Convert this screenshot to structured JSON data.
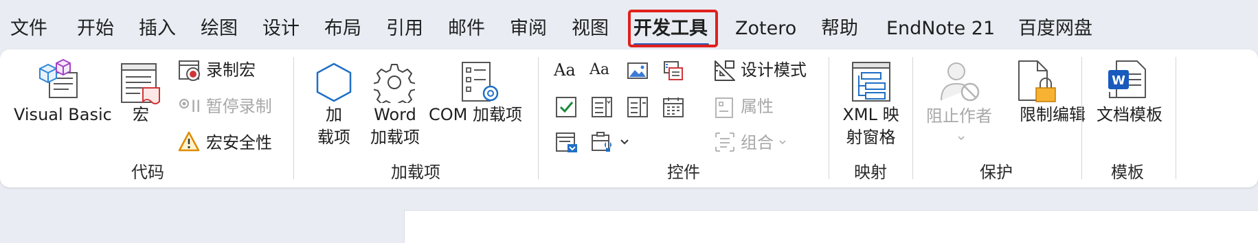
{
  "tabs": [
    {
      "id": "file",
      "label": "文件"
    },
    {
      "id": "home",
      "label": "开始"
    },
    {
      "id": "insert",
      "label": "插入"
    },
    {
      "id": "draw",
      "label": "绘图"
    },
    {
      "id": "design",
      "label": "设计"
    },
    {
      "id": "layout",
      "label": "布局"
    },
    {
      "id": "references",
      "label": "引用"
    },
    {
      "id": "mailings",
      "label": "邮件"
    },
    {
      "id": "review",
      "label": "审阅"
    },
    {
      "id": "view",
      "label": "视图"
    },
    {
      "id": "developer",
      "label": "开发工具",
      "active": true
    },
    {
      "id": "zotero",
      "label": "Zotero"
    },
    {
      "id": "help",
      "label": "帮助"
    },
    {
      "id": "endnote",
      "label": "EndNote 21"
    },
    {
      "id": "baidu",
      "label": "百度网盘"
    }
  ],
  "groups": {
    "code": {
      "label": "代码",
      "visual_basic": "Visual Basic",
      "macros": "宏",
      "record_macro": "录制宏",
      "pause_recording": "II 暂停录制",
      "macro_security": "宏安全性"
    },
    "addins": {
      "label": "加载项",
      "addins_line1": "加",
      "addins_line2": "载项",
      "word_addins_line1": "Word",
      "word_addins_line2": "加载项",
      "com_addins": "COM 加载项"
    },
    "controls": {
      "label": "控件",
      "design_mode": "设计模式",
      "properties": "属性",
      "group": "组合"
    },
    "mapping": {
      "label": "映射",
      "xml_line1": "XML 映",
      "xml_line2": "射窗格"
    },
    "protect": {
      "label": "保护",
      "block_authors": "阻止作者",
      "restrict_editing": "限制编辑"
    },
    "templates": {
      "label": "模板",
      "document_template": "文档模板"
    }
  },
  "colors": {
    "accent": "#2b59b5",
    "highlight": "#e0201c",
    "ribbon_bg": "#ffffff",
    "window_bg": "#e9edf3",
    "disabled_text": "#a8a8a8"
  }
}
